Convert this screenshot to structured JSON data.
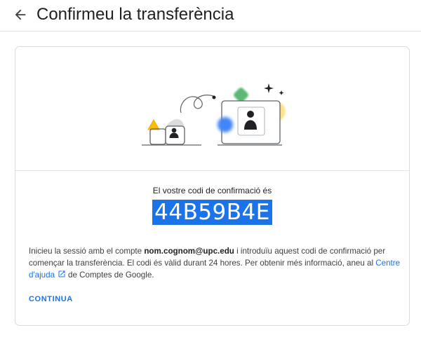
{
  "header": {
    "title": "Confirmeu la transferència",
    "back_icon": "arrow-back-icon"
  },
  "card": {
    "code_label": "El vostre codi de confirmació és",
    "code": "44B59B4E",
    "code_highlight_color": "#1a73e8",
    "instructions": {
      "part1": "Inicieu la sessió amb el compte ",
      "email": "nom.cognom@upc.edu",
      "part2": " i introduïu aquest codi de confirmació per començar la transferència. El codi és vàlid durant 24 hores. Per obtenir més informació, aneu al ",
      "help_link": "Centre d'ajuda",
      "help_icon": "open-in-new-icon",
      "part3": "de Comptes de Google."
    },
    "continue_label": "CONTINUA"
  },
  "colors": {
    "accent": "#1a73e8",
    "green": "#34a853",
    "yellow": "#fbbc04",
    "blue": "#4285f4"
  }
}
